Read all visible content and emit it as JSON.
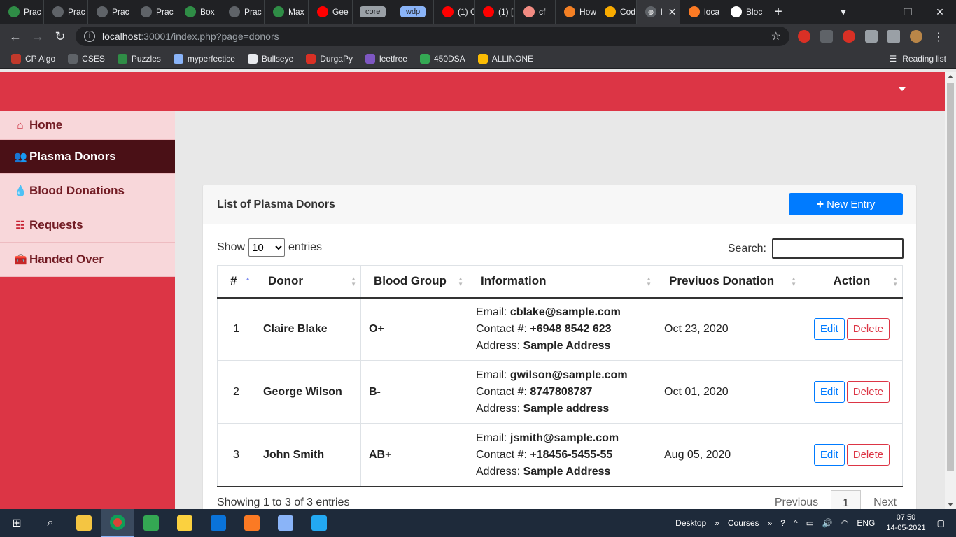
{
  "browser": {
    "tabs": [
      {
        "label": "Prac",
        "icon": "gfg-icon",
        "color": "#2f8d46"
      },
      {
        "label": "Prac",
        "icon": "globe-icon",
        "color": "#5f6368"
      },
      {
        "label": "Prac",
        "icon": "globe-icon",
        "color": "#5f6368"
      },
      {
        "label": "Prac",
        "icon": "globe-icon",
        "color": "#5f6368"
      },
      {
        "label": "Box",
        "icon": "gfg-icon",
        "color": "#2f8d46"
      },
      {
        "label": "Prac",
        "icon": "globe-icon",
        "color": "#5f6368"
      },
      {
        "label": "Max",
        "icon": "gfg-icon",
        "color": "#2f8d46"
      },
      {
        "label": "Gee",
        "icon": "youtube-icon",
        "color": "#ff0000"
      }
    ],
    "pill_tabs": [
      {
        "label": "core",
        "color": "#9aa0a6"
      },
      {
        "label": "wdp",
        "color": "#8ab4f8"
      }
    ],
    "tabs2": [
      {
        "label": "(1) C",
        "icon": "youtube-icon",
        "color": "#ff0000"
      },
      {
        "label": "(1) [",
        "icon": "youtube-icon",
        "color": "#ff0000"
      },
      {
        "label": "cf",
        "icon": "cf-icon",
        "color": "#f28b82"
      },
      {
        "label": "How",
        "icon": "stackoverflow-icon",
        "color": "#f48024"
      },
      {
        "label": "Cod",
        "icon": "gear-icon",
        "color": "#f9ab00"
      }
    ],
    "active_tab": {
      "label": "l"
    },
    "tabs3": [
      {
        "label": "loca",
        "icon": "xampp-icon",
        "color": "#fb7a24"
      },
      {
        "label": "Bloc",
        "icon": "github-icon",
        "color": "#ffffff"
      }
    ],
    "url_host": "localhost",
    "url_path": ":30001/index.php?page=donors",
    "bookmarks": [
      {
        "label": "CP Algo",
        "color": "#c0392b"
      },
      {
        "label": "CSES",
        "color": "#5f6368"
      },
      {
        "label": "Puzzles",
        "color": "#2f8d46"
      },
      {
        "label": "myperfectice",
        "color": "#8ab4f8"
      },
      {
        "label": "Bullseye",
        "color": "#e8eaed"
      },
      {
        "label": "DurgaPy",
        "color": "#d93025"
      },
      {
        "label": "leetfree",
        "color": "#7e57c2"
      },
      {
        "label": "450DSA",
        "color": "#34a853"
      },
      {
        "label": "ALLINONE",
        "color": "#fbbc04"
      }
    ],
    "reading_list": "Reading list"
  },
  "sidebar": {
    "items": [
      {
        "label": "Home",
        "icon": "home-icon"
      },
      {
        "label": "Plasma Donors",
        "icon": "users-icon"
      },
      {
        "label": "Blood Donations",
        "icon": "droplet-icon"
      },
      {
        "label": "Requests",
        "icon": "table-icon"
      },
      {
        "label": "Handed Over",
        "icon": "toolbox-icon"
      }
    ],
    "active": "Plasma Donors"
  },
  "card": {
    "title": "List of Plasma Donors",
    "new_entry": "New Entry",
    "show": "Show",
    "entries": "entries",
    "length_value": "10",
    "search_label": "Search:",
    "search_value": ""
  },
  "table": {
    "columns": [
      "#",
      "Donor",
      "Blood Group",
      "Information",
      "Previuos Donation",
      "Action"
    ],
    "rows": [
      {
        "num": "1",
        "donor": "Claire Blake",
        "blood": "O+",
        "email": "cblake@sample.com",
        "contact": "+6948 8542 623",
        "address": "Sample Address",
        "date": "Oct 23, 2020"
      },
      {
        "num": "2",
        "donor": "George Wilson",
        "blood": "B-",
        "email": "gwilson@sample.com",
        "contact": "8747808787",
        "address": "Sample address",
        "date": "Oct 01, 2020"
      },
      {
        "num": "3",
        "donor": "John Smith",
        "blood": "AB+",
        "email": "jsmith@sample.com",
        "contact": "+18456-5455-55",
        "address": "Sample Address",
        "date": "Aug 05, 2020"
      }
    ],
    "email_label": "Email:",
    "contact_label": "Contact #:",
    "address_label": "Address:",
    "edit": "Edit",
    "delete": "Delete"
  },
  "footer": {
    "info": "Showing 1 to 3 of 3 entries",
    "previous": "Previous",
    "page": "1",
    "next": "Next"
  },
  "taskbar": {
    "desktop": "Desktop",
    "courses": "Courses",
    "lang": "ENG",
    "time": "07:50",
    "date": "14-05-2021"
  },
  "colors": {
    "accent_red": "#dc3545",
    "primary_blue": "#007bff",
    "sidebar_active": "#4a1016",
    "sidebar_item": "#f8d7da"
  }
}
